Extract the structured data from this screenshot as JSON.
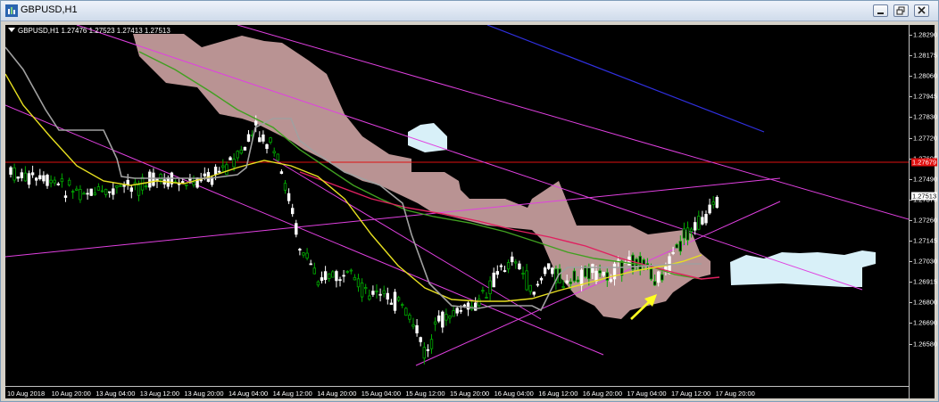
{
  "window": {
    "title": "GBPUSD,H1",
    "controls": [
      "minimize",
      "restore",
      "close"
    ]
  },
  "chart": {
    "legend": "GBPUSD,H1  1.27476 1.27523 1.27413 1.27513",
    "current_price": "1.27513",
    "marked_level": "1.27679",
    "price_labels": [
      "1.28290",
      "1.28175",
      "1.28060",
      "1.27945",
      "1.27830",
      "1.27720",
      "1.27605",
      "1.27490",
      "1.27375",
      "1.27260",
      "1.27145",
      "1.27030",
      "1.26915",
      "1.26800",
      "1.26690",
      "1.26580"
    ],
    "time_labels": [
      "10 Aug 2018",
      "10 Aug 20:00",
      "13 Aug 04:00",
      "13 Aug 12:00",
      "13 Aug 20:00",
      "14 Aug 04:00",
      "14 Aug 12:00",
      "14 Aug 20:00",
      "15 Aug 04:00",
      "15 Aug 12:00",
      "15 Aug 20:00",
      "16 Aug 04:00",
      "16 Aug 12:00",
      "16 Aug 20:00",
      "17 Aug 04:00",
      "17 Aug 12:00",
      "17 Aug 20:00"
    ],
    "colors": {
      "background": "#000000",
      "bull_candle": "#ffffff",
      "bear_candle": "#00aa00",
      "cloud_bearish": "#c9a0a0",
      "cloud_bullish": "#d8f0f8",
      "horizontal_line": "#e01010",
      "trend_lines": "#e040e0",
      "ma_yellow": "#e8e020",
      "ma_green": "#40a020",
      "ma_red": "#e02060",
      "kijun_gray": "#a0a0a0",
      "arrow": "#ffff20"
    }
  }
}
